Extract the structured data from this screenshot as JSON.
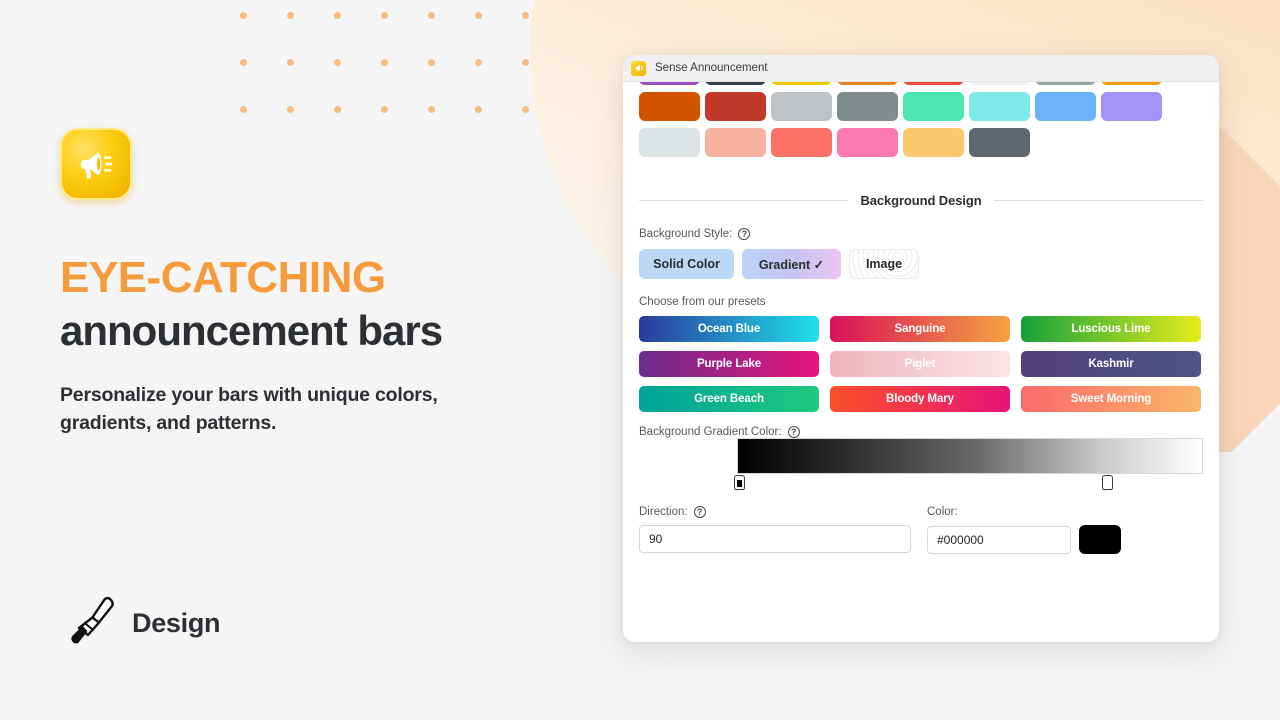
{
  "hero": {
    "app_icon": "megaphone-icon",
    "headline_accent": "EYE-CATCHING",
    "headline_main": "announcement bars",
    "subcopy": "Personalize your bars with unique colors, gradients, and patterns.",
    "footer_icon": "paintbrush-icon",
    "footer_label": "Design",
    "accent_color": "#f79a3c",
    "text_color": "#2c2f33",
    "dot_color": "#f7bd7e"
  },
  "window": {
    "favicon": "megaphone-favicon",
    "title": "Sense Announcement"
  },
  "swatches": {
    "row_top_partial": [
      "#9b4fc0",
      "#2c3e50",
      "#f0c808",
      "#e8821e",
      "#e74c3c",
      "#edf0f1",
      "#95a5a6",
      "#f0a00c"
    ],
    "row_middle": [
      "#d35400",
      "#c0392b",
      "#bdc3c7",
      "#7f8c8d",
      "#4ae8b0",
      "#7eeaea",
      "#6cb2fb",
      "#a493f7"
    ],
    "row_bottom": [
      "#dde4e6",
      "#f7b3a0",
      "#fb7168",
      "#fb79ae",
      "#fac96b",
      "#5d676d"
    ]
  },
  "background_design": {
    "section_title": "Background Design",
    "style_label": "Background Style:",
    "help_icon": "question-mark-icon",
    "styles": [
      {
        "label": "Solid Color",
        "selected": false
      },
      {
        "label": "Gradient ✓",
        "selected": true
      },
      {
        "label": "Image",
        "selected": false
      }
    ],
    "presets_label": "Choose from our presets",
    "presets": [
      {
        "name": "Ocean Blue",
        "from": "#2a3a9c",
        "to": "#1fe0ee"
      },
      {
        "name": "Sanguine",
        "from": "#d81159",
        "to": "#f5a341"
      },
      {
        "name": "Luscious Lime",
        "from": "#14a13a",
        "to": "#e7ec1c"
      },
      {
        "name": "Purple Lake",
        "from": "#6b2d8c",
        "to": "#e8157c"
      },
      {
        "name": "Piglet",
        "from": "#eeb3bd",
        "to": "#fbe4e9"
      },
      {
        "name": "Kashmir",
        "from": "#53417e",
        "to": "#4e5486"
      },
      {
        "name": "Green Beach",
        "from": "#00a39a",
        "to": "#1fc97e"
      },
      {
        "name": "Bloody Mary",
        "from": "#fd4f2a",
        "to": "#e51577"
      },
      {
        "name": "Sweet Morning",
        "from": "#fb6a6a",
        "to": "#fbb56a"
      }
    ],
    "gradient_color_label": "Background Gradient Color:",
    "gradient_from": "#000000",
    "gradient_to": "#ffffff",
    "direction_label": "Direction:",
    "direction_value": "90",
    "direction_placeholder": "90",
    "color_label": "Color:",
    "color_value": "#000000",
    "color_placeholder": "#000000",
    "color_chip": "#000000"
  }
}
